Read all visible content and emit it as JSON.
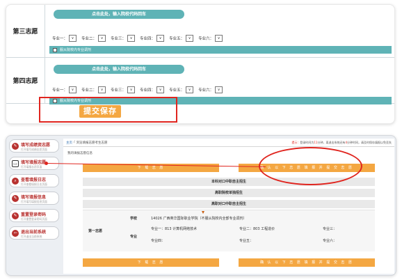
{
  "top": {
    "rows": [
      {
        "label": "第三志愿",
        "school_prompt": "点击此处，输入院校代码回车",
        "majors": [
          "专业一：",
          "专业二：",
          "专业三：",
          "专业四：",
          "专业五：",
          "专业六："
        ],
        "adjust_text": "服从院校内专业调剂"
      },
      {
        "label": "第四志愿",
        "school_prompt": "点击此处，输入院校代码回车",
        "majors": [
          "专业一：",
          "专业二：",
          "专业三：",
          "专业四：",
          "专业五：",
          "专业六："
        ],
        "adjust_text": "服从院校内专业调剂"
      }
    ],
    "select_arrow": "∨",
    "submit_label": "提交保存"
  },
  "bottom": {
    "sidebar": [
      {
        "icon": "edit-icon",
        "title": "填写成绩资志愿",
        "subtitle": "打开填写成绩志愿页面"
      },
      {
        "icon": "document-icon",
        "title": "填写填报志愿",
        "subtitle": "打开填报志愿页面"
      },
      {
        "icon": "search-icon",
        "title": "查看填报日志",
        "subtitle": "打开查看填报日志页面"
      },
      {
        "icon": "edit-icon",
        "title": "填写填报信息",
        "subtitle": "打开填写填报信息页面"
      },
      {
        "icon": "edit-icon",
        "title": "重置登录密码",
        "subtitle": "打开重置登录密码页面"
      },
      {
        "icon": "logout-icon",
        "title": "退出当前系统",
        "subtitle": "打开退出当前系统"
      }
    ],
    "breadcrumb": {
      "home": "主页",
      "separator": "/",
      "current": "浏览填报志愿考生志愿"
    },
    "notice": {
      "tip": "提示：",
      "text_a": "登录时间为",
      "minutes": "11",
      "text_b": "分钟，离退出系统还有",
      "remaining": "4",
      "text_c": "分钟时间，请及时保存填报以免丢失"
    },
    "page_subtitle": "我的填报志愿信息",
    "buttons": {
      "download": "下 载 志 愿",
      "confirm": "确 认 以 下 志 愿 填 报 并 提 交 志 愿"
    },
    "banners": [
      "本科对口中职自主招生",
      "高职院校单独招生",
      "高职对口中职自主招生"
    ],
    "detail": {
      "choice_label": "第一志愿",
      "school_label": "学校",
      "school_value": "14026 广西英华国际职业学院（不服从院校内全部专业调剂）",
      "major_label": "专业",
      "majors": [
        "专业一：813 计算机网络技术",
        "专业二：803 工程造价",
        "专业三：",
        "专业四：",
        "专业五：",
        "专业六："
      ]
    }
  }
}
